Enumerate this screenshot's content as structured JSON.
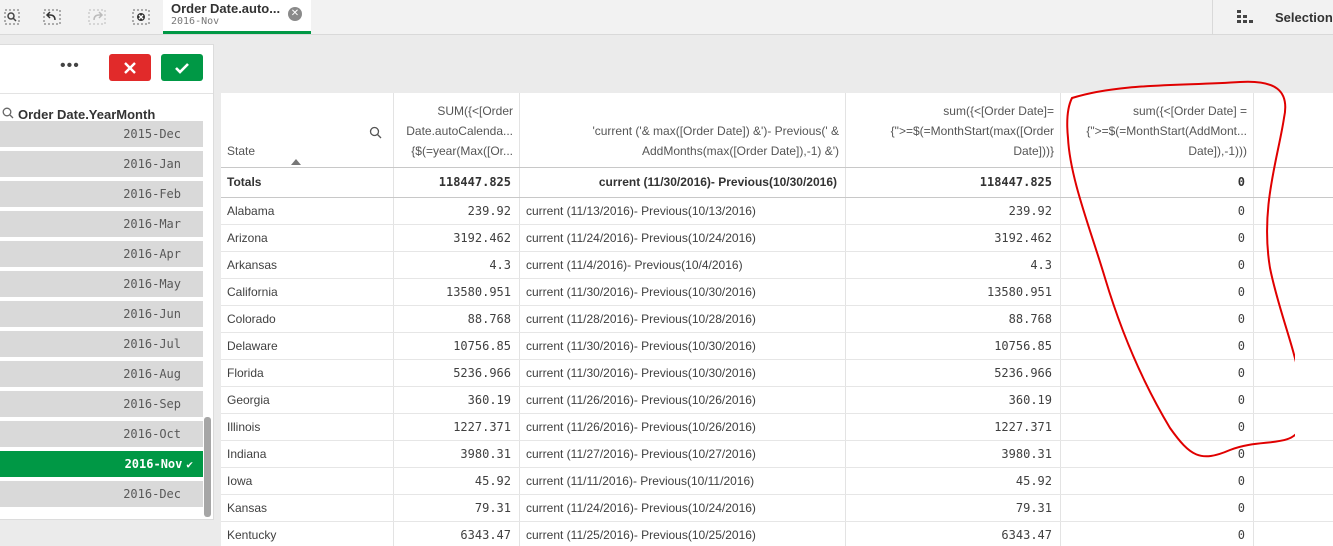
{
  "selection_tab": {
    "title": "Order Date.auto...",
    "value": "2016-Nov"
  },
  "right_panel": {
    "label": "Selections"
  },
  "listbox": {
    "field_title": "Order Date.YearMonth",
    "items": [
      {
        "label": "2015-Dec",
        "selected": false
      },
      {
        "label": "2016-Jan",
        "selected": false
      },
      {
        "label": "2016-Feb",
        "selected": false
      },
      {
        "label": "2016-Mar",
        "selected": false
      },
      {
        "label": "2016-Apr",
        "selected": false
      },
      {
        "label": "2016-May",
        "selected": false
      },
      {
        "label": "2016-Jun",
        "selected": false
      },
      {
        "label": "2016-Jul",
        "selected": false
      },
      {
        "label": "2016-Aug",
        "selected": false
      },
      {
        "label": "2016-Sep",
        "selected": false
      },
      {
        "label": "2016-Oct",
        "selected": false
      },
      {
        "label": "2016-Nov",
        "selected": true
      },
      {
        "label": "2016-Dec",
        "selected": false
      }
    ]
  },
  "table": {
    "headers": [
      [
        "State"
      ],
      [
        "SUM({<[Order",
        "Date.autoCalenda...",
        "{$(=year(Max([Or..."
      ],
      [
        "'current ('& max([Order Date]) &')- Previous(' &",
        "AddMonths(max([Order Date]),-1) &')"
      ],
      [
        "sum({<[Order Date]=",
        "{\">=$(=MonthStart(max([Order",
        "Date]))}"
      ],
      [
        "sum({<[Order Date] =",
        "{\">=$(=MonthStart(AddMont...",
        "Date]),-1)))"
      ]
    ],
    "totals": [
      "Totals",
      "118447.825",
      "current (11/30/2016)- Previous(10/30/2016)",
      "118447.825",
      "0"
    ],
    "rows": [
      [
        "Alabama",
        "239.92",
        "current (11/13/2016)- Previous(10/13/2016)",
        "239.92",
        "0"
      ],
      [
        "Arizona",
        "3192.462",
        "current (11/24/2016)- Previous(10/24/2016)",
        "3192.462",
        "0"
      ],
      [
        "Arkansas",
        "4.3",
        "current (11/4/2016)- Previous(10/4/2016)",
        "4.3",
        "0"
      ],
      [
        "California",
        "13580.951",
        "current (11/30/2016)- Previous(10/30/2016)",
        "13580.951",
        "0"
      ],
      [
        "Colorado",
        "88.768",
        "current (11/28/2016)- Previous(10/28/2016)",
        "88.768",
        "0"
      ],
      [
        "Delaware",
        "10756.85",
        "current (11/30/2016)- Previous(10/30/2016)",
        "10756.85",
        "0"
      ],
      [
        "Florida",
        "5236.966",
        "current (11/30/2016)- Previous(10/30/2016)",
        "5236.966",
        "0"
      ],
      [
        "Georgia",
        "360.19",
        "current (11/26/2016)- Previous(10/26/2016)",
        "360.19",
        "0"
      ],
      [
        "Illinois",
        "1227.371",
        "current (11/26/2016)- Previous(10/26/2016)",
        "1227.371",
        "0"
      ],
      [
        "Indiana",
        "3980.31",
        "current (11/27/2016)- Previous(10/27/2016)",
        "3980.31",
        "0"
      ],
      [
        "Iowa",
        "45.92",
        "current (11/11/2016)- Previous(10/11/2016)",
        "45.92",
        "0"
      ],
      [
        "Kansas",
        "79.31",
        "current (11/24/2016)- Previous(10/24/2016)",
        "79.31",
        "0"
      ],
      [
        "Kentucky",
        "6343.47",
        "current (11/25/2016)- Previous(10/25/2016)",
        "6343.47",
        "0"
      ]
    ]
  },
  "colors": {
    "accent_green": "#009845",
    "cancel_red": "#e12a2a",
    "annotation": "#e00000"
  }
}
